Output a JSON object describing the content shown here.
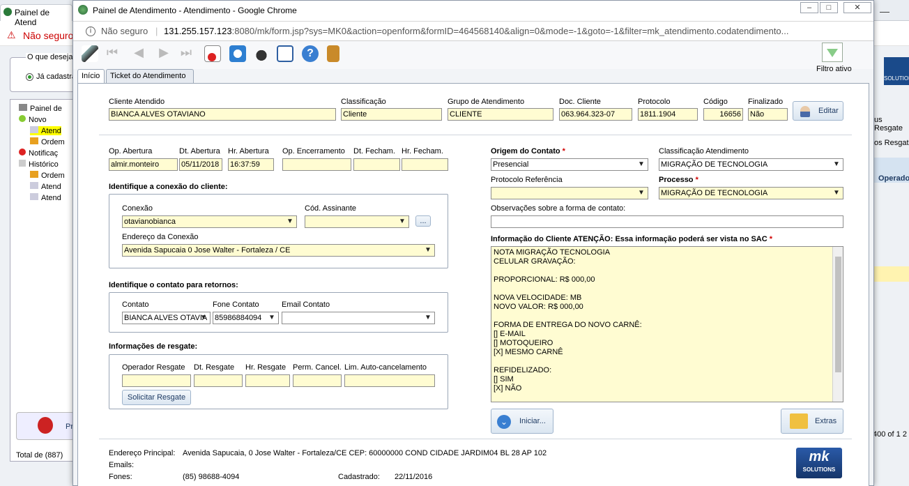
{
  "background": {
    "tab_title": "Painel de Atend",
    "security": "Não seguro",
    "left_panel": {
      "question": "O que deseja",
      "radio_label": "Já cadastra",
      "tree": [
        "Painel de",
        "Novo",
        "Atend",
        "Ordem",
        "Notificaç",
        "Histórico",
        "Ordem",
        "Atend",
        "Atend"
      ],
      "total": "Total de (887)",
      "pra": "Pra"
    },
    "right_panel": {
      "items": [
        "us Resgate",
        "os Resgat",
        "Operado",
        "400 of 1 2"
      ],
      "logo_text": "SOLUTION"
    }
  },
  "window": {
    "title": "Painel de Atendimento - Atendimento - Google Chrome",
    "security": "Não seguro",
    "url_host": "131.255.157.123",
    "url_rest": ":8080/mk/form.jsp?sys=MK0&action=openform&formID=464568140&align=0&mode=-1&goto=-1&filter=mk_atendimento.codatendimento..."
  },
  "toolbar": {
    "icons": [
      "edit-pen-icon",
      "first-icon",
      "prev-icon",
      "next-icon",
      "last-icon",
      "delete-doc-icon",
      "refresh-icon",
      "spy-icon",
      "form-icon",
      "help-icon",
      "exit-door-icon"
    ],
    "filter_label": "Filtro ativo"
  },
  "tabs": [
    "Início",
    "Ticket do Atendimento"
  ],
  "header": {
    "cliente_label": "Cliente Atendido",
    "cliente": "BIANCA ALVES OTAVIANO",
    "classificacao_label": "Classificação",
    "classificacao": "Cliente",
    "grupo_label": "Grupo de Atendimento",
    "grupo": "CLIENTE",
    "doc_label": "Doc. Cliente",
    "doc": "063.964.323-07",
    "protocolo_label": "Protocolo",
    "protocolo": "1811.1904",
    "codigo_label": "Código",
    "codigo": "16656",
    "finalizado_label": "Finalizado",
    "finalizado": "Não",
    "editar": "Editar"
  },
  "abertura": {
    "op_label": "Op. Abertura",
    "op": "almir.monteiro",
    "dt_label": "Dt. Abertura",
    "dt": "05/11/2018",
    "hr_label": "Hr. Abertura",
    "hr": "16:37:59",
    "op_enc_label": "Op. Encerramento",
    "op_enc": "",
    "dt_fech_label": "Dt. Fecham.",
    "dt_fech": "",
    "hr_fech_label": "Hr. Fecham.",
    "hr_fech": ""
  },
  "conexao": {
    "section": "Identifique a conexão do cliente:",
    "conexao_label": "Conexão",
    "conexao": "otavianobianca",
    "cod_label": "Cód. Assinante",
    "cod": "",
    "more": "...",
    "endereco_label": "Endereço da Conexão",
    "endereco": "Avenida Sapucaia 0 Jose Walter - Fortaleza / CE"
  },
  "contato": {
    "section": "Identifique o contato para retornos:",
    "contato_label": "Contato",
    "contato": "BIANCA ALVES OTAVIA",
    "fone_label": "Fone Contato",
    "fone": "85986884094",
    "email_label": "Email Contato",
    "email": ""
  },
  "resgate": {
    "section": "Informações de resgate:",
    "op_label": "Operador Resgate",
    "dt_label": "Dt. Resgate",
    "hr_label": "Hr. Resgate",
    "perm_label": "Perm. Cancel.",
    "lim_label": "Lim. Auto-cancelamento",
    "solicitar": "Solicitar Resgate"
  },
  "origem": {
    "origem_label": "Origem do Contato",
    "origem": "Presencial",
    "class_label": "Classificação Atendimento",
    "class": "MIGRAÇÃO DE TECNOLOGIA",
    "protref_label": "Protocolo Referência",
    "protref": "",
    "processo_label": "Processo",
    "processo": "MIGRAÇÃO DE TECNOLOGIA",
    "obs_label": "Observações sobre a forma de contato:",
    "obs": "",
    "info_label": "Informação do Cliente ATENÇÃO: Essa informação poderá ser vista no SAC",
    "info_text": "NOTA MIGRAÇÃO TECNOLOGIA\nCELULAR GRAVAÇÃO:\n\nPROPORCIONAL: R$ 000,00\n\nNOVA VELOCIDADE: MB\nNOVO VALOR: R$ 000,00\n\nFORMA DE ENTREGA DO NOVO CARNÊ:\n[] E-MAIL\n[] MOTOQUEIRO\n[X] MESMO CARNÊ\n\nREFIDELIZADO:\n[] SIM\n[X] NÃO",
    "iniciar": "Iniciar...",
    "extras": "Extras",
    "required_mark": "*"
  },
  "footer": {
    "end_label": "Endereço Principal:",
    "end": "Avenida Sapucaia, 0 Jose Walter - Fortaleza/CE CEP: 60000000 COND CIDADE JARDIM04 BL 28 AP 102",
    "emails_label": "Emails:",
    "fones_label": "Fones:",
    "fones": "(85) 98688-4094",
    "cad_label": "Cadastrado:",
    "cad": "22/11/2016",
    "logo_top": "mk",
    "logo_bottom": "SOLUTIONS"
  },
  "colors": {
    "field": "#fffcd2",
    "accent": "#1f3b63",
    "required": "#d00000"
  }
}
